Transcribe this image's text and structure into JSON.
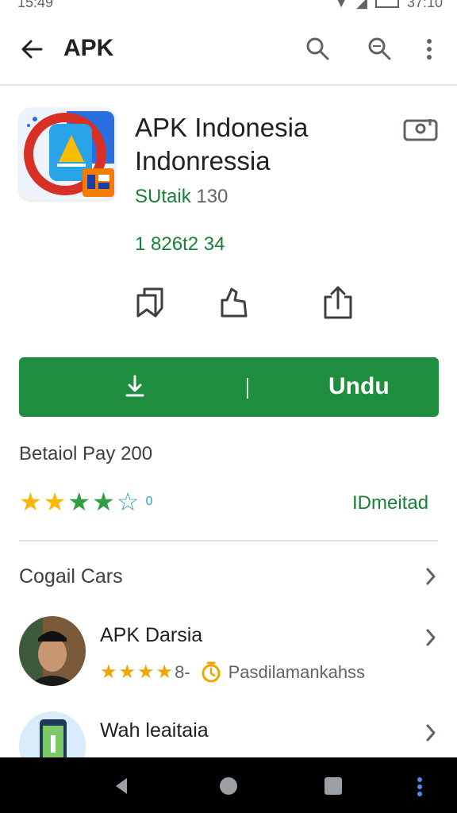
{
  "status_bar": {
    "time": "15:49",
    "battery": "37:10"
  },
  "app_bar": {
    "title": "APK",
    "icons": [
      "back-arrow-icon",
      "search-icon",
      "search-icon",
      "more-vert-icon"
    ]
  },
  "app": {
    "name": "APK Indonesia Indonressia",
    "publisher_label": "SUtaik",
    "publisher_number": "130",
    "meta": "1 826t2 34"
  },
  "actions": [
    "bookmark-icon",
    "thumbs-up-icon",
    "share-icon"
  ],
  "install": {
    "label": "Undu"
  },
  "price": "Betaiol Pay 200",
  "rating": {
    "stars_filled": 4,
    "stars_total": 5,
    "count": "0",
    "installed_label": "IDmeitad"
  },
  "section": {
    "title": "Cogail Cars",
    "items": [
      {
        "name": "APK Darsia",
        "rating_text": "8-",
        "sub_text": "Pasdilamankahss"
      },
      {
        "name": "Wah leaitaia"
      }
    ]
  },
  "colors": {
    "primary_green": "#1e8e3e",
    "text_green": "#188038",
    "star_yellow": "#f9b800",
    "star_green": "#2ea043",
    "star_outline": "#34a1c9",
    "nav_bg": "#000000"
  }
}
